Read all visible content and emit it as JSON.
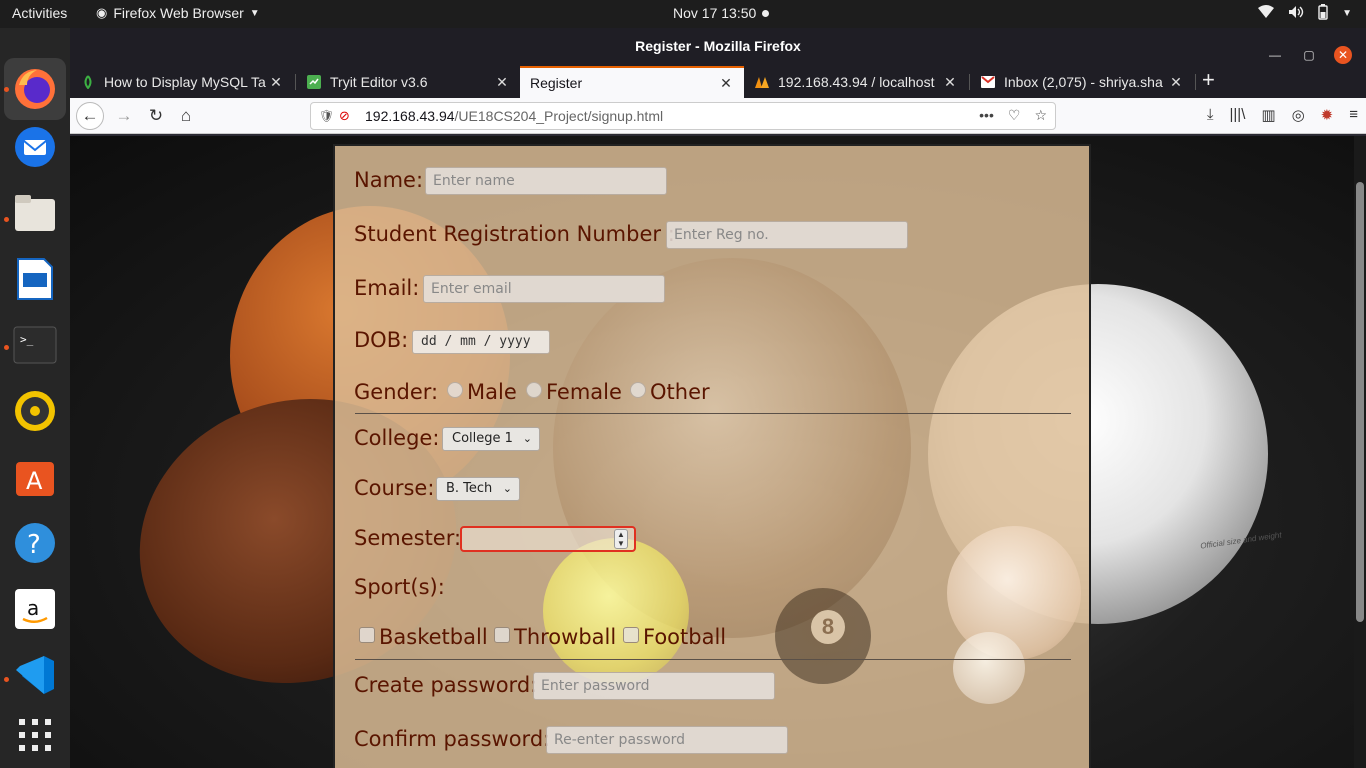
{
  "topbar": {
    "activities": "Activities",
    "app_name": "Firefox Web Browser",
    "clock": "Nov 17  13:50"
  },
  "window": {
    "title": "Register - Mozilla Firefox"
  },
  "tabs": [
    {
      "label": "How to Display MySQL Ta",
      "icon": "sheets-icon"
    },
    {
      "label": "Tryit Editor v3.6",
      "icon": "tryit-icon"
    },
    {
      "label": "Register",
      "icon": "none"
    },
    {
      "label": "192.168.43.94 / localhost",
      "icon": "phpmyadmin-icon"
    },
    {
      "label": "Inbox (2,075) - shriya.sha",
      "icon": "gmail-icon"
    }
  ],
  "url": {
    "host": "192.168.43.94",
    "path": "/UE18CS204_Project/signup.html"
  },
  "form": {
    "name_label": "Name:",
    "name_placeholder": "Enter name",
    "srn_label": "Student Registration Number :",
    "srn_placeholder": "Enter Reg no.",
    "email_label": "Email:",
    "email_placeholder": "Enter email",
    "dob_label": "DOB:",
    "dob_value": "dd / mm / yyyy",
    "gender_label": "Gender:",
    "gender_options": [
      "Male",
      "Female",
      "Other"
    ],
    "college_label": "College:",
    "college_value": "College 1",
    "course_label": "Course:",
    "course_value": "B. Tech",
    "semester_label": "Semester:",
    "sports_label": "Sport(s):",
    "sports_options": [
      "Basketball",
      "Throwball",
      "Football"
    ],
    "create_password_label": "Create password:",
    "create_password_placeholder": "Enter password",
    "confirm_password_label": "Confirm password:",
    "confirm_password_placeholder": "Re-enter password"
  },
  "background": {
    "volleyball_text": "Official size and weight"
  },
  "colors": {
    "label": "#5a1500",
    "accent": "#e95420",
    "tab_active_border": "#e66000"
  }
}
